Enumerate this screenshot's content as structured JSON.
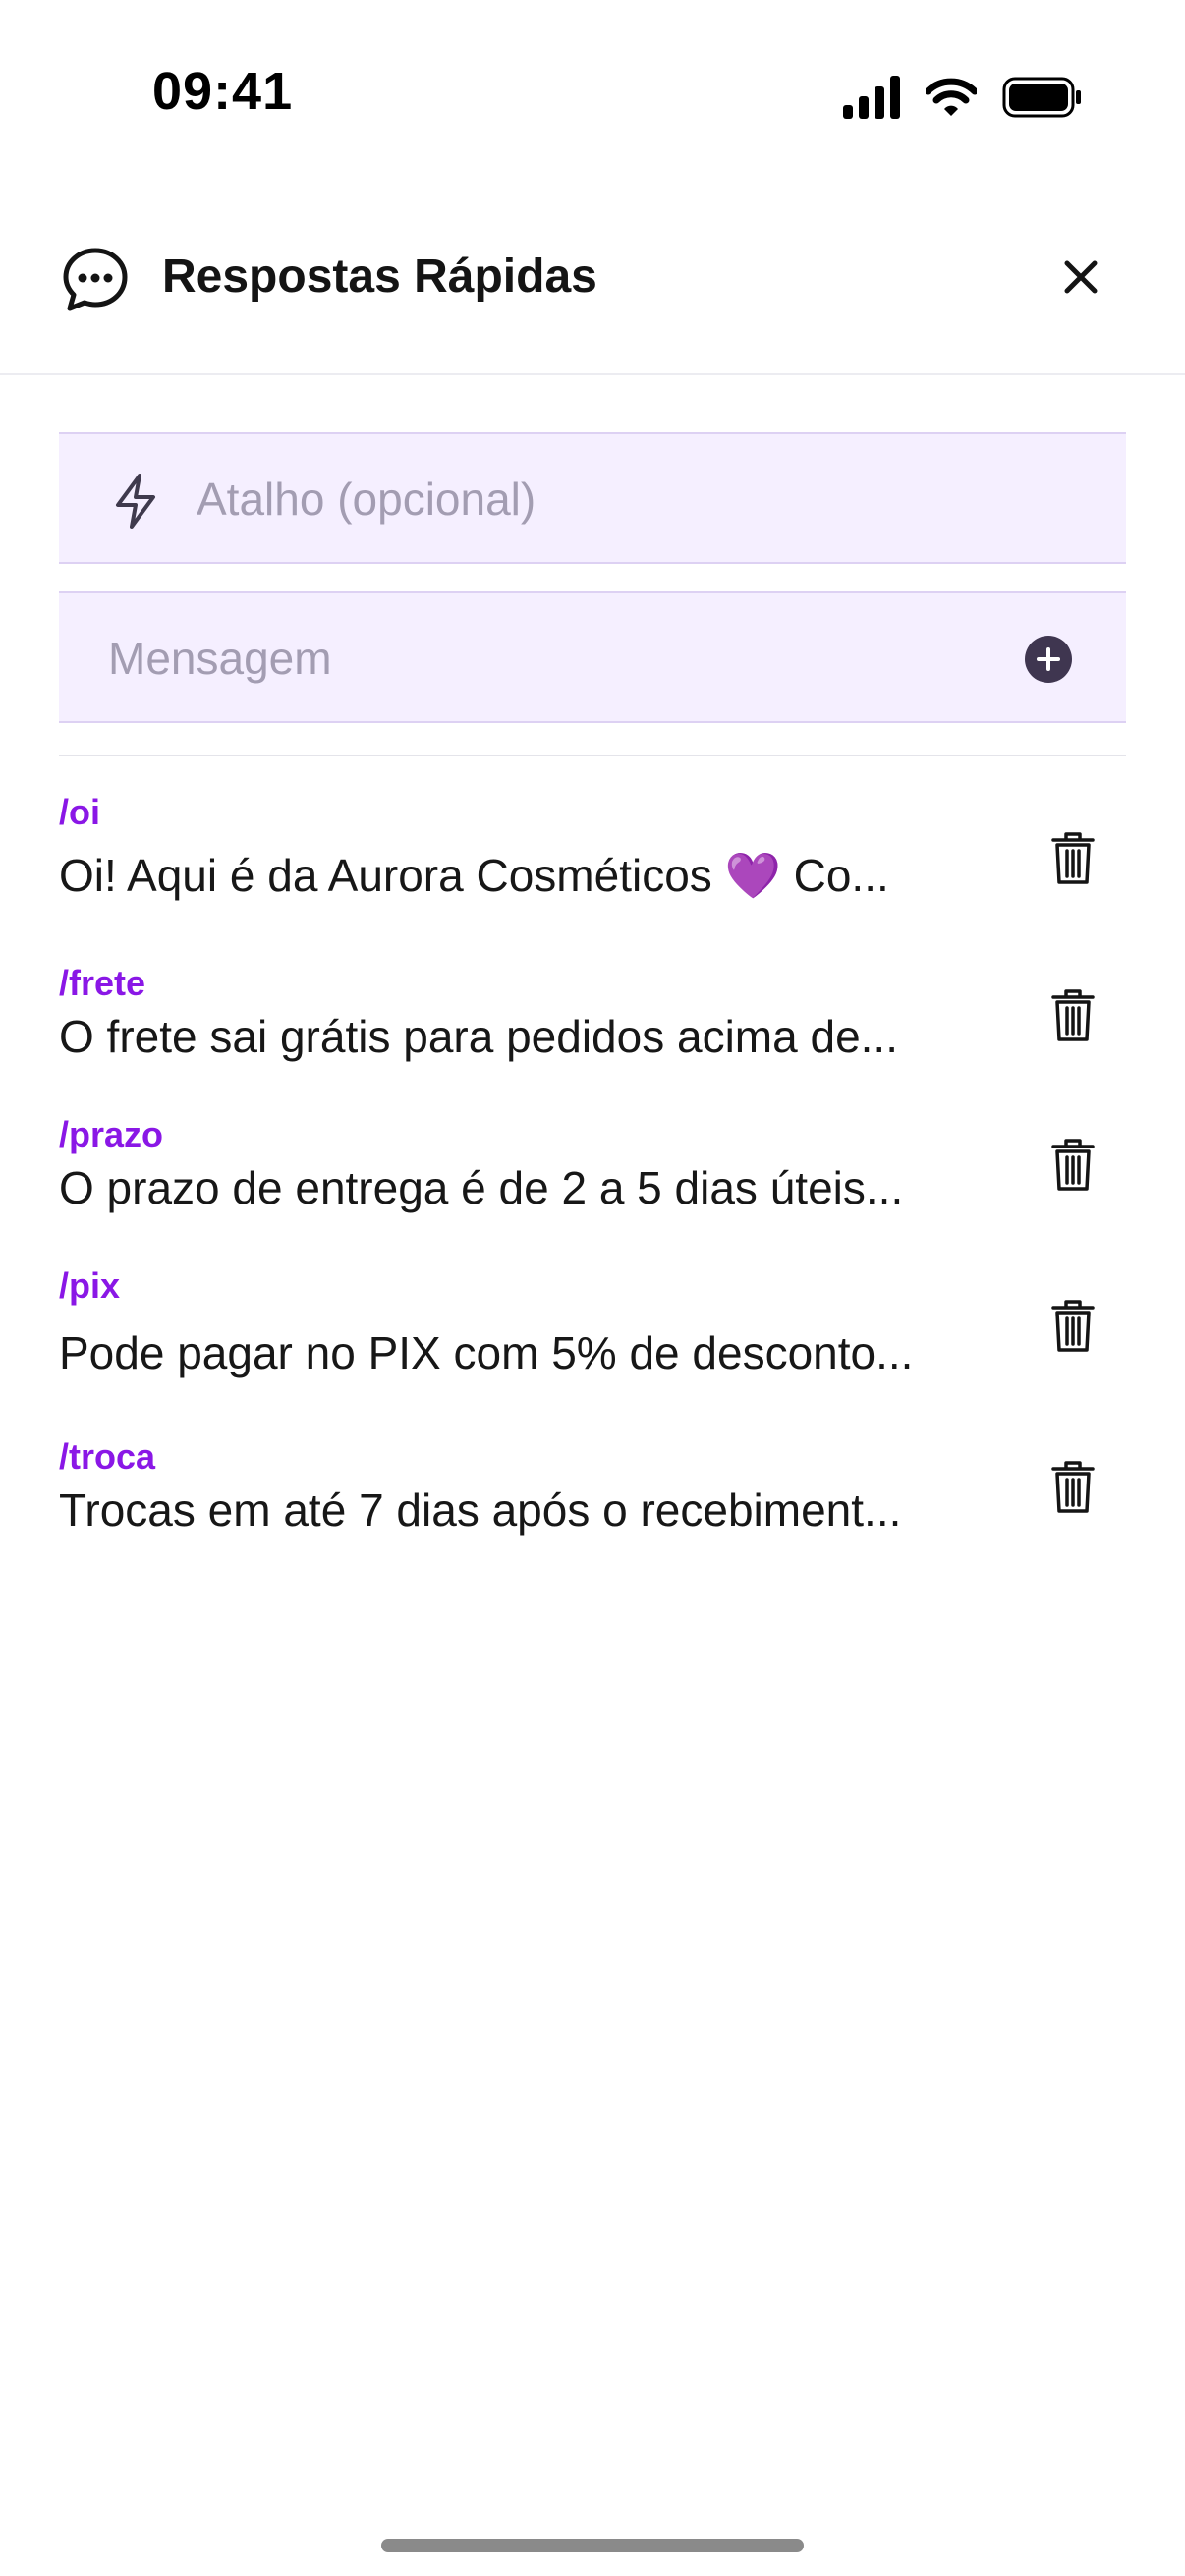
{
  "status_bar": {
    "time": "09:41",
    "icons": [
      "signal-icon",
      "wifi-icon",
      "battery-icon"
    ]
  },
  "header": {
    "title": "Respostas Rápidas",
    "icon": "chat-bubble-icon",
    "close_icon": "close-icon"
  },
  "form": {
    "shortcut_placeholder": "Atalho (opcional)",
    "shortcut_value": "",
    "shortcut_icon": "bolt-icon",
    "message_placeholder": "Mensagem",
    "message_value": "",
    "add_icon": "plus-circle-icon"
  },
  "replies": [
    {
      "shortcut": "/oi",
      "text": "Oi! Aqui é da Aurora Cosméticos 💜 Co..."
    },
    {
      "shortcut": "/frete",
      "text": "O frete sai grátis para pedidos acima de..."
    },
    {
      "shortcut": "/prazo",
      "text": "O prazo de entrega é de 2 a 5 dias úteis..."
    },
    {
      "shortcut": "/pix",
      "text": "Pode pagar no PIX com 5% de desconto..."
    },
    {
      "shortcut": "/troca",
      "text": "Trocas em até 7 dias após o recebiment..."
    }
  ],
  "colors": {
    "accent": "#8a17e6",
    "input_background": "#f5efff",
    "input_border": "#ddd1f3",
    "add_button": "#3f3650"
  }
}
